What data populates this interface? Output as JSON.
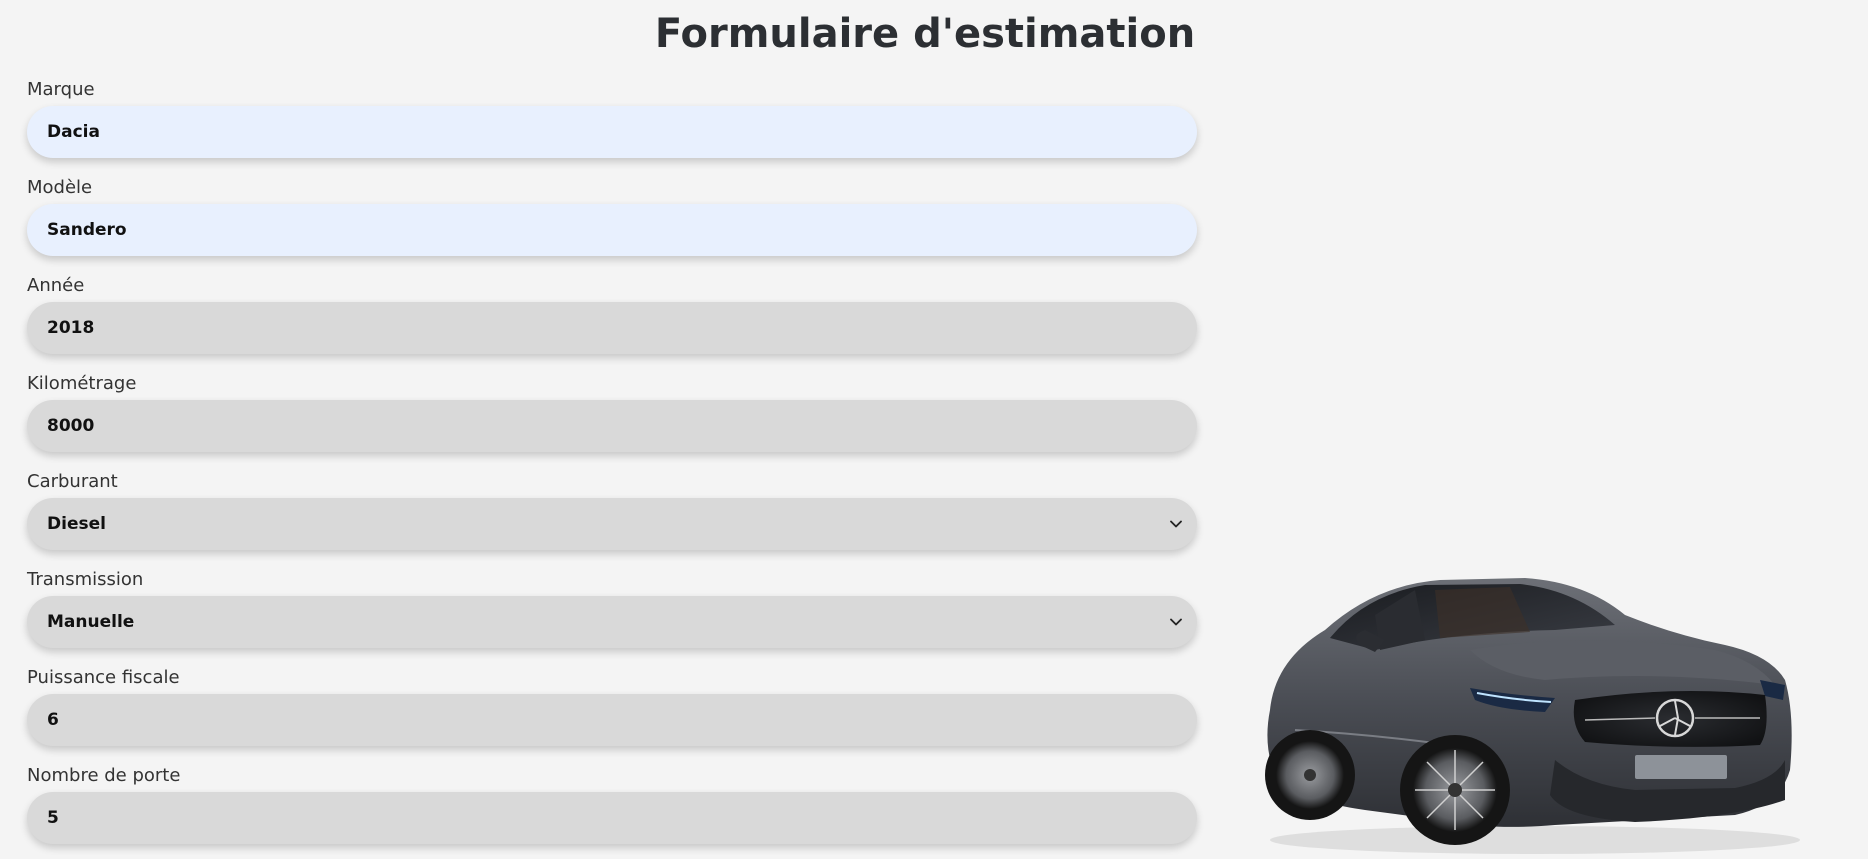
{
  "title": "Formulaire d'estimation",
  "fields": [
    {
      "label": "Marque",
      "value": "Dacia",
      "type": "text"
    },
    {
      "label": "Modèle",
      "value": "Sandero",
      "type": "text"
    },
    {
      "label": "Année",
      "value": "2018",
      "type": "text"
    },
    {
      "label": "Kilométrage",
      "value": "8000",
      "type": "text"
    },
    {
      "label": "Carburant",
      "value": "Diesel",
      "type": "select"
    },
    {
      "label": "Transmission",
      "value": "Manuelle",
      "type": "select"
    },
    {
      "label": "Puissance fiscale",
      "value": "6",
      "type": "text"
    },
    {
      "label": "Nombre de porte",
      "value": "5",
      "type": "text"
    }
  ],
  "icons": {
    "select_arrow": "chevron-down-icon",
    "car": "car-image"
  },
  "colors": {
    "background": "#f4f4f4",
    "field_background": "#d9d9d9",
    "autofill_background": "#e8f0fe",
    "title": "#2c2f33"
  }
}
